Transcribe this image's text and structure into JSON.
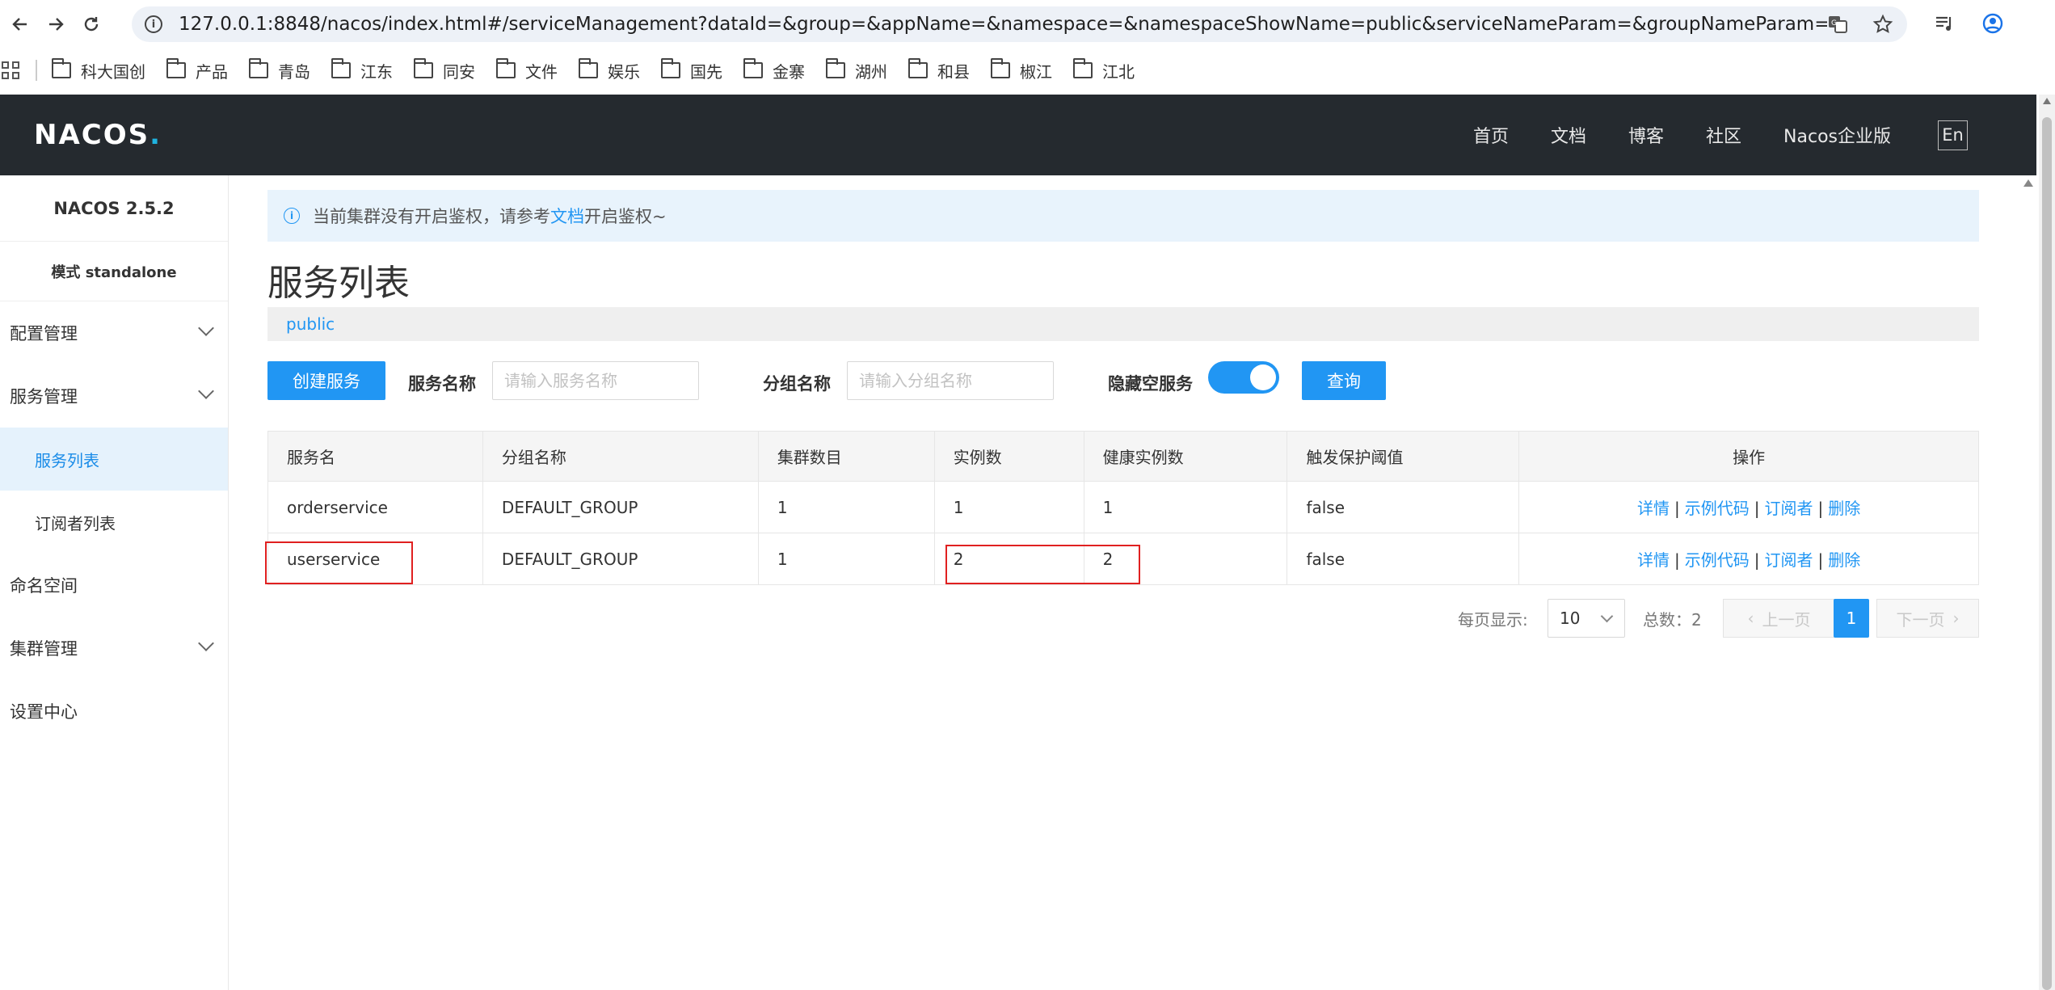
{
  "browser": {
    "url": "127.0.0.1:8848/nacos/index.html#/serviceManagement?dataId=&group=&appName=&namespace=&namespaceShowName=public&serviceNameParam=&groupNameParam=&pageSize=&pageNo=",
    "bookmarks": [
      "科大国创",
      "产品",
      "青岛",
      "江东",
      "同安",
      "文件",
      "娱乐",
      "国先",
      "金寨",
      "湖州",
      "和县",
      "椒江",
      "江北"
    ]
  },
  "header": {
    "logo": "NACOS",
    "logo_dot": ".",
    "nav": [
      "首页",
      "文档",
      "博客",
      "社区",
      "Nacos企业版"
    ],
    "lang": "En"
  },
  "sidebar": {
    "version": "NACOS 2.5.2",
    "mode": "模式 standalone",
    "items": [
      {
        "label": "配置管理"
      },
      {
        "label": "服务管理"
      },
      {
        "label": "服务列表"
      },
      {
        "label": "订阅者列表"
      },
      {
        "label": "命名空间"
      },
      {
        "label": "集群管理"
      },
      {
        "label": "设置中心"
      }
    ]
  },
  "notice": {
    "prefix": "当前集群没有开启鉴权，请参考",
    "link": "文档",
    "suffix": "开启鉴权~"
  },
  "page": {
    "title": "服务列表",
    "namespace": "public"
  },
  "filters": {
    "create_label": "创建服务",
    "service_name_label": "服务名称",
    "service_name_placeholder": "请输入服务名称",
    "group_name_label": "分组名称",
    "group_name_placeholder": "请输入分组名称",
    "hide_empty_label": "隐藏空服务",
    "hide_empty_on": true,
    "query_label": "查询"
  },
  "table": {
    "headers": [
      "服务名",
      "分组名称",
      "集群数目",
      "实例数",
      "健康实例数",
      "触发保护阈值",
      "操作"
    ],
    "rows": [
      {
        "name": "orderservice",
        "group": "DEFAULT_GROUP",
        "clusters": "1",
        "instances": "1",
        "healthy": "1",
        "threshold": "false"
      },
      {
        "name": "userservice",
        "group": "DEFAULT_GROUP",
        "clusters": "1",
        "instances": "2",
        "healthy": "2",
        "threshold": "false"
      }
    ],
    "ops": [
      "详情",
      "示例代码",
      "订阅者",
      "删除"
    ],
    "op_sep": "|"
  },
  "pagination": {
    "per_page_label": "每页显示:",
    "page_size": "10",
    "total_label": "总数：2",
    "prev": "上一页",
    "next": "下一页",
    "current": "1"
  }
}
